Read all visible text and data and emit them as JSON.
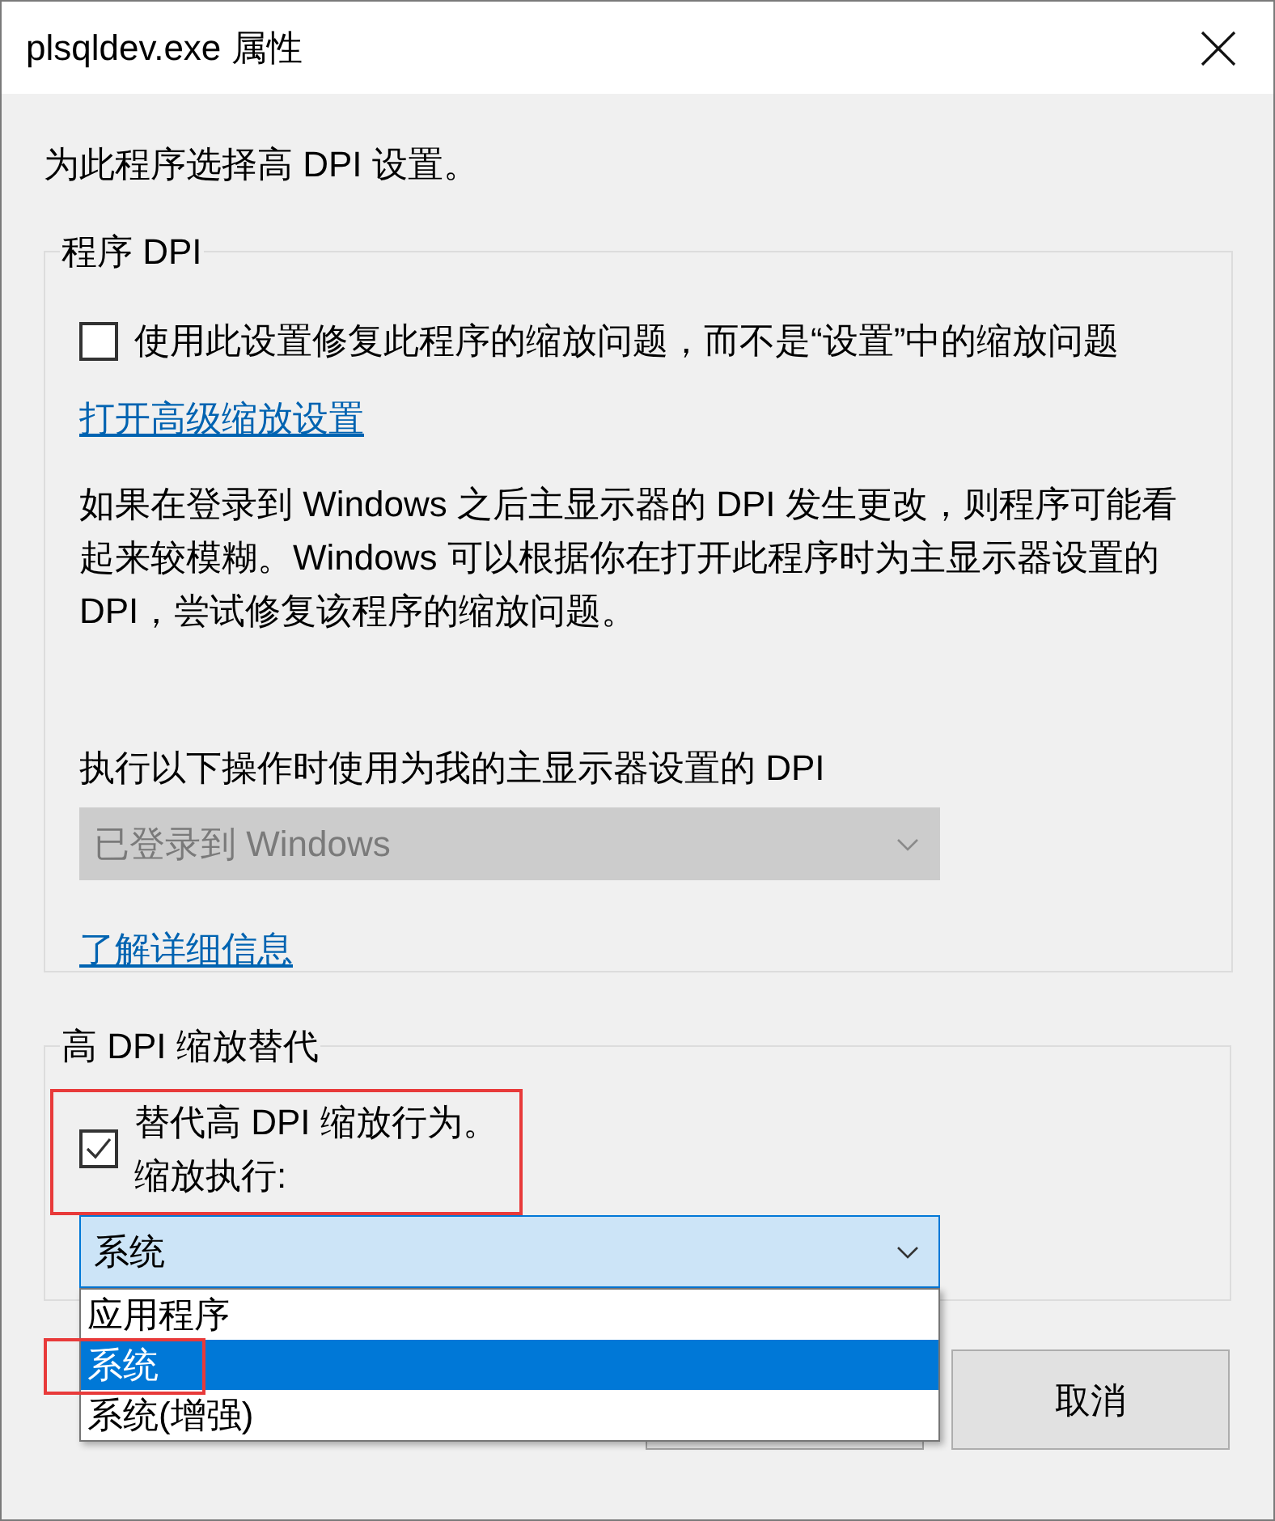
{
  "window": {
    "title": "plsqldev.exe 属性"
  },
  "intro": "为此程序选择高 DPI 设置。",
  "program_dpi": {
    "legend": "程序 DPI",
    "checkbox": {
      "label": "使用此设置修复此程序的缩放问题，而不是“设置”中的缩放问题",
      "checked": false
    },
    "link": "打开高级缩放设置",
    "description": "如果在登录到 Windows 之后主显示器的 DPI 发生更改，则程序可能看起来较模糊。Windows 可以根据你在打开此程序时为主显示器设置的 DPI，尝试修复该程序的缩放问题。",
    "dropdown_label": "执行以下操作时使用为我的主显示器设置的 DPI",
    "dropdown": {
      "value": "已登录到 Windows",
      "disabled": true
    },
    "learn_more": "了解详细信息"
  },
  "override": {
    "legend": "高 DPI 缩放替代",
    "checkbox": {
      "lines": [
        "替代高 DPI 缩放行为。",
        "缩放执行:"
      ],
      "checked": true
    },
    "combo": {
      "value": "系统",
      "expanded": true,
      "options": [
        {
          "label": "应用程序",
          "selected": false
        },
        {
          "label": "系统",
          "selected": true
        },
        {
          "label": "系统(增强)",
          "selected": false
        }
      ]
    }
  },
  "buttons": [
    {
      "kind": "ok"
    },
    {
      "kind": "cancel",
      "label": "取消"
    }
  ]
}
